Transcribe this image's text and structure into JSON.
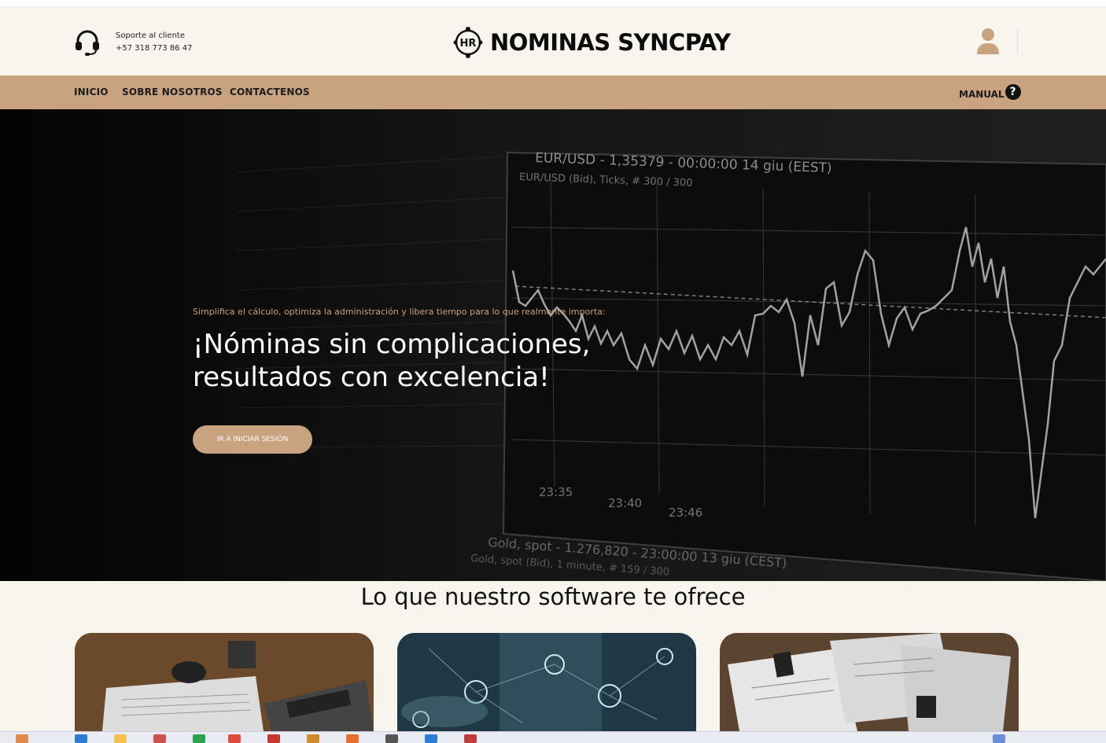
{
  "header": {
    "support_label": "Soporte al cliente",
    "support_phone": "+57 318 773 86 47",
    "brand_name": "NOMINAS SYNCPAY",
    "logo_text": "HR"
  },
  "nav": {
    "items": [
      "INICIO",
      "SOBRE NOSOTROS",
      "CONTACTENOS"
    ],
    "manual_label": "MANUAL",
    "help_symbol": "?"
  },
  "hero": {
    "subtitle": "Simplifica el cálculo, optimiza la administración y libera tiempo para lo que realmente importa:",
    "title_line1": "¡Nóminas sin complicaciones,",
    "title_line2": "resultados con excelencia!",
    "button_label": "IR A INICIAR SESIÓN",
    "chart_labels": {
      "pair": "EUR/USD - 1,35379 - 00:00:00 14 giu (EEST)",
      "ticks": "EUR/USD (Bid), Ticks, # 300 / 300",
      "t1": "23:35",
      "t2": "23:40",
      "t3": "23:46",
      "gold": "Gold, spot - 1.276,820 - 23:00:00 13 giu (CEST)",
      "gold2": "Gold, spot (Bid), 1 minute, # 159 / 300"
    }
  },
  "features": {
    "section_title": "Lo que nuestro software te ofrece",
    "cards": [
      {
        "name": "calculator-desk-image"
      },
      {
        "name": "network-business-image"
      },
      {
        "name": "documents-clips-image"
      }
    ]
  },
  "colors": {
    "accent": "#c9a27f",
    "background": "#f8f5ef",
    "text": "#111111"
  }
}
